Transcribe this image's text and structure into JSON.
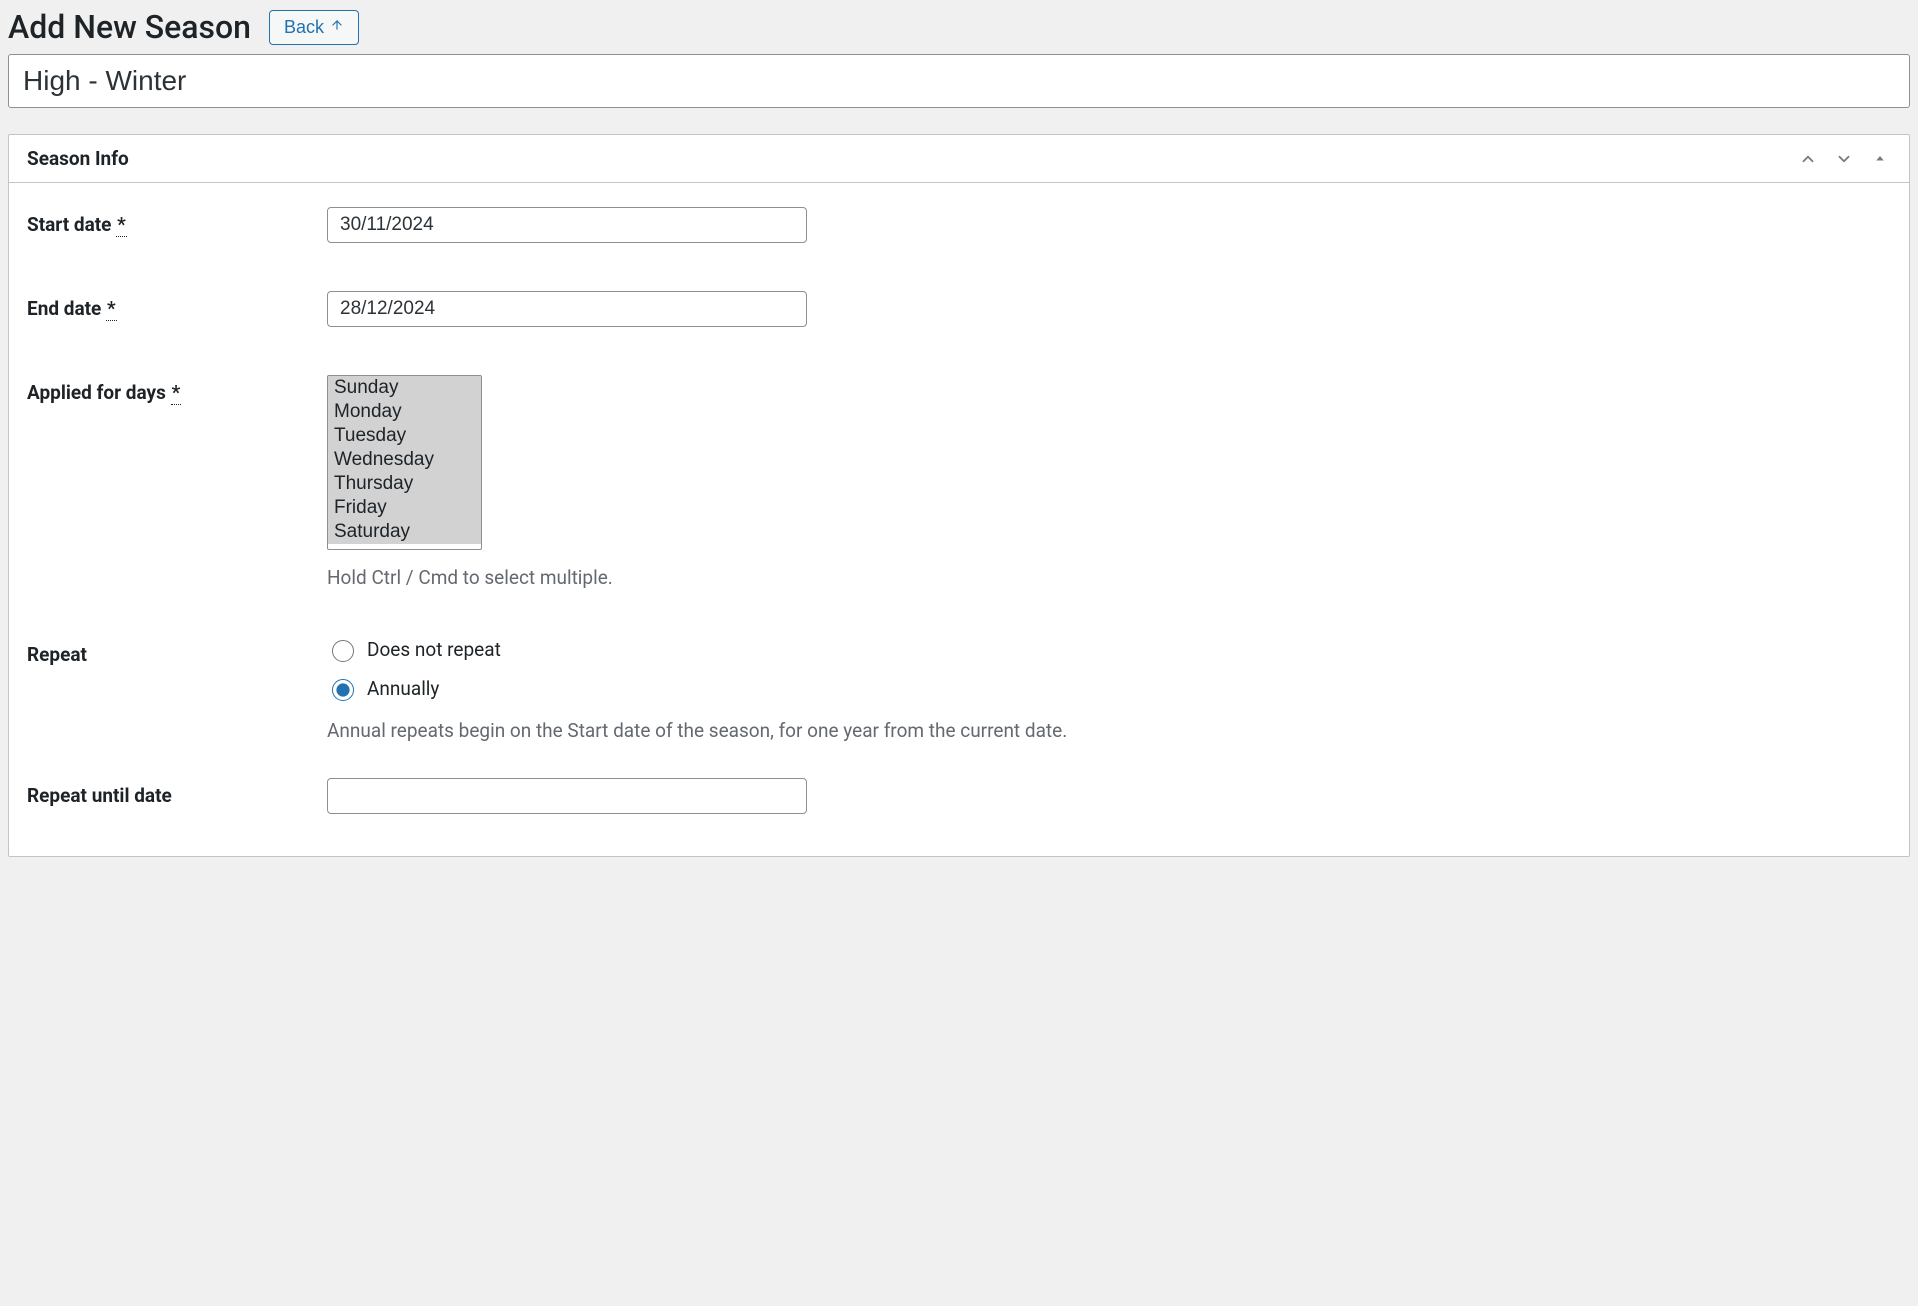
{
  "header": {
    "title": "Add New Season",
    "back_label": "Back"
  },
  "season": {
    "name": "High - Winter"
  },
  "metabox": {
    "title": "Season Info"
  },
  "fields": {
    "start_date": {
      "label": "Start date",
      "required_mark": "*",
      "value": "30/11/2024"
    },
    "end_date": {
      "label": "End date",
      "required_mark": "*",
      "value": "28/12/2024"
    },
    "applied_days": {
      "label": "Applied for days",
      "required_mark": "*",
      "options": [
        "Sunday",
        "Monday",
        "Tuesday",
        "Wednesday",
        "Thursday",
        "Friday",
        "Saturday"
      ],
      "hint": "Hold Ctrl / Cmd to select multiple."
    },
    "repeat": {
      "label": "Repeat",
      "options": {
        "none": "Does not repeat",
        "annually": "Annually"
      },
      "selected": "annually",
      "note": "Annual repeats begin on the Start date of the season, for one year from the current date."
    },
    "repeat_until": {
      "label": "Repeat until date",
      "value": ""
    }
  }
}
